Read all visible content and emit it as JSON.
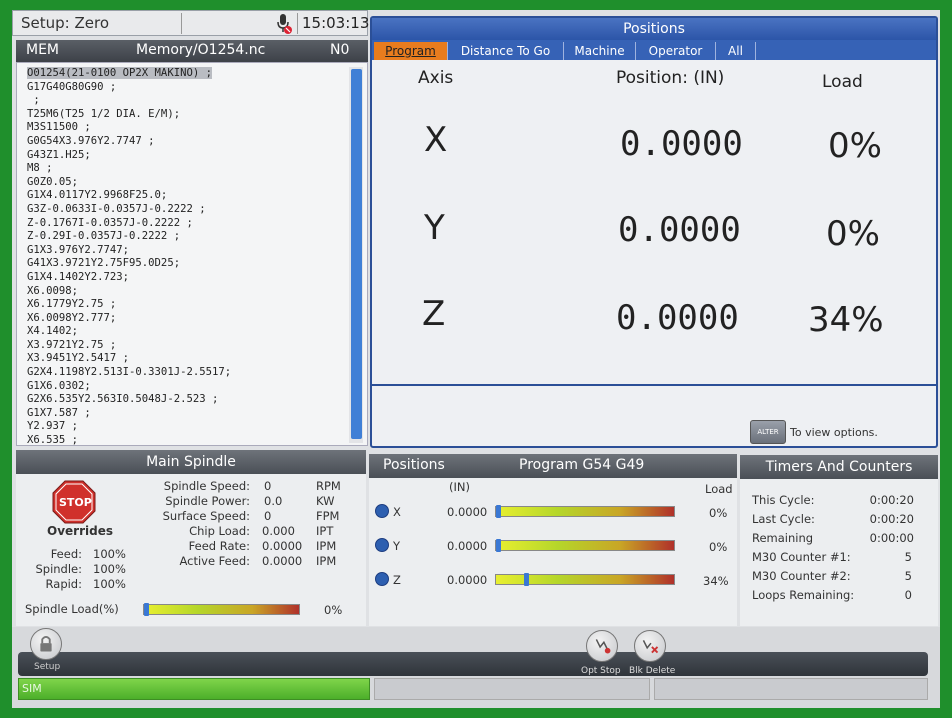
{
  "topbar": {
    "setup_label": "Setup: Zero",
    "clock": "15:03:13",
    "mic_icon": "mic-muted-icon"
  },
  "program": {
    "mode": "MEM",
    "file": "Memory/O1254.nc",
    "line_no": "N0",
    "lines": [
      "O01254(21-0100 OP2X MAKINO) ;",
      "G17G40G80G90 ;",
      " ;",
      "T25M6(T25 1/2 DIA. E/M);",
      "M3S11500 ;",
      "G0G54X3.976Y2.7747 ;",
      "G43Z1.H25;",
      "M8 ;",
      "G0Z0.05;",
      "G1X4.0117Y2.9968F25.0;",
      "G3Z-0.0633I-0.0357J-0.2222 ;",
      "Z-0.1767I-0.0357J-0.2222 ;",
      "Z-0.29I-0.0357J-0.2222 ;",
      "G1X3.976Y2.7747;",
      "G41X3.9721Y2.75F95.0D25;",
      "G1X4.1402Y2.723;",
      "X6.0098;",
      "X6.1779Y2.75 ;",
      "X6.0098Y2.777;",
      "X4.1402;",
      "X3.9721Y2.75 ;",
      "X3.9451Y2.5417 ;",
      "G2X4.1198Y2.513I-0.3301J-2.5517;",
      "G1X6.0302;",
      "G2X6.535Y2.563I0.5048J-2.523 ;",
      "G1X7.587 ;",
      "Y2.937 ;",
      "X6.535 ;"
    ]
  },
  "positions": {
    "title": "Positions",
    "tabs": [
      "Program",
      "Distance To Go",
      "Machine",
      "Operator",
      "All"
    ],
    "active_tab": "Program",
    "col_axis": "Axis",
    "col_position": "Position:  (IN)",
    "col_load": "Load",
    "rows": [
      {
        "axis": "X",
        "value": "0.0000",
        "load": "0%"
      },
      {
        "axis": "Y",
        "value": "0.0000",
        "load": "0%"
      },
      {
        "axis": "Z",
        "value": "0.0000",
        "load": "34%"
      }
    ],
    "alter_label": "ALTER",
    "alter_hint": "To view options."
  },
  "spindle": {
    "title": "Main Spindle",
    "stop_label": "STOP",
    "overrides_label": "Overrides",
    "overrides": [
      {
        "name": "Feed:",
        "value": "100%"
      },
      {
        "name": "Spindle:",
        "value": "100%"
      },
      {
        "name": "Rapid:",
        "value": "100%"
      }
    ],
    "stats": [
      {
        "name": "Spindle Speed:",
        "value": "0",
        "unit": "RPM"
      },
      {
        "name": "Spindle Power:",
        "value": "0.0",
        "unit": "KW"
      },
      {
        "name": "Surface Speed:",
        "value": "0",
        "unit": "FPM"
      },
      {
        "name": "Chip Load:",
        "value": "0.000",
        "unit": "IPT"
      },
      {
        "name": "Feed Rate:",
        "value": "0.0000",
        "unit": "IPM"
      },
      {
        "name": "Active Feed:",
        "value": "0.0000",
        "unit": "IPM"
      }
    ],
    "load_label": "Spindle Load(%)",
    "load_value": "0%",
    "load_fraction": 0.0
  },
  "small_positions": {
    "title": "Positions",
    "subtitle": "Program G54 G49",
    "unit": "(IN)",
    "load_label": "Load",
    "rows": [
      {
        "axis": "X",
        "value": "0.0000",
        "load": "0%",
        "fraction": 0.0
      },
      {
        "axis": "Y",
        "value": "0.0000",
        "load": "0%",
        "fraction": 0.0
      },
      {
        "axis": "Z",
        "value": "0.0000",
        "load": "34%",
        "fraction": 0.16
      }
    ]
  },
  "timers": {
    "title": "Timers And Counters",
    "rows": [
      {
        "name": "This Cycle:",
        "value": "0:00:20"
      },
      {
        "name": "Last Cycle:",
        "value": "0:00:20"
      },
      {
        "name": "Remaining",
        "value": "0:00:00"
      },
      {
        "name": "M30 Counter #1:",
        "value": "5"
      },
      {
        "name": "M30 Counter #2:",
        "value": "5"
      },
      {
        "name": "Loops Remaining:",
        "value": "0"
      }
    ]
  },
  "bottom": {
    "setup_label": "Setup",
    "opt_stop_label": "Opt Stop",
    "blk_delete_label": "Blk Delete",
    "status_text": "SIM"
  }
}
